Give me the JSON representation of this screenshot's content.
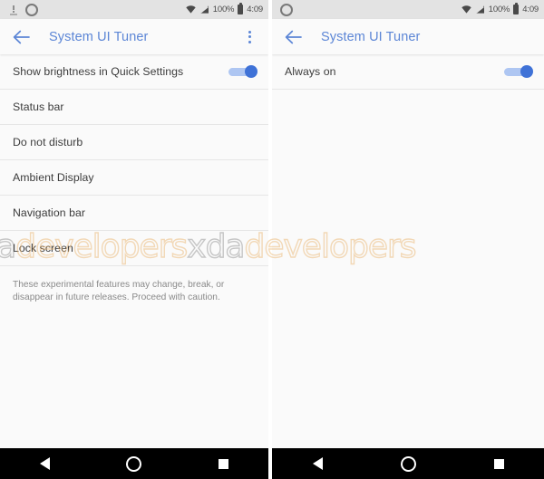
{
  "screens": [
    {
      "id": "left",
      "statusbar": {
        "notification_icons": [
          "alert-icon",
          "circle-icon"
        ],
        "wifi_icon": "wifi-icon",
        "signal_icon": "cell-signal-icon",
        "battery_percent": "100%",
        "battery_icon": "battery-icon",
        "clock": "4:09"
      },
      "toolbar": {
        "back_icon": "back-arrow-icon",
        "title": "System UI Tuner",
        "overflow_icon": "overflow-menu-icon",
        "has_overflow": true
      },
      "rows": [
        {
          "label": "Show brightness in Quick Settings",
          "toggle": true,
          "toggle_on": true
        },
        {
          "label": "Status bar",
          "toggle": false
        },
        {
          "label": "Do not disturb",
          "toggle": false
        },
        {
          "label": "Ambient Display",
          "toggle": false
        },
        {
          "label": "Navigation bar",
          "toggle": false
        },
        {
          "label": "Lock screen",
          "toggle": false
        }
      ],
      "footer_note": "These experimental features may change, break, or disappear in future releases. Proceed with caution.",
      "navbar": {
        "back": "nav-back-icon",
        "home": "nav-home-icon",
        "recents": "nav-recents-icon"
      }
    },
    {
      "id": "right",
      "statusbar": {
        "notification_icons": [
          "circle-icon"
        ],
        "wifi_icon": "wifi-icon",
        "signal_icon": "cell-signal-icon",
        "battery_percent": "100%",
        "battery_icon": "battery-icon",
        "clock": "4:09"
      },
      "toolbar": {
        "back_icon": "back-arrow-icon",
        "title": "System UI Tuner",
        "overflow_icon": "overflow-menu-icon",
        "has_overflow": false
      },
      "rows": [
        {
          "label": "Always on",
          "toggle": true,
          "toggle_on": true
        }
      ],
      "footer_note": "",
      "navbar": {
        "back": "nav-back-icon",
        "home": "nav-home-icon",
        "recents": "nav-recents-icon"
      }
    }
  ],
  "watermark": {
    "brand_left": "xda",
    "brand_right": "developers"
  },
  "colors": {
    "accent_blue": "#5c86d6",
    "toggle_track": "#aec6f2",
    "toggle_thumb": "#3f72d7",
    "statusbar_bg": "#e3e3e3",
    "page_bg": "#fafafa",
    "navbar_bg": "#000000",
    "divider": "#e6e6e6",
    "text_primary": "#3c3c3c",
    "text_muted": "#8a8a8a"
  }
}
